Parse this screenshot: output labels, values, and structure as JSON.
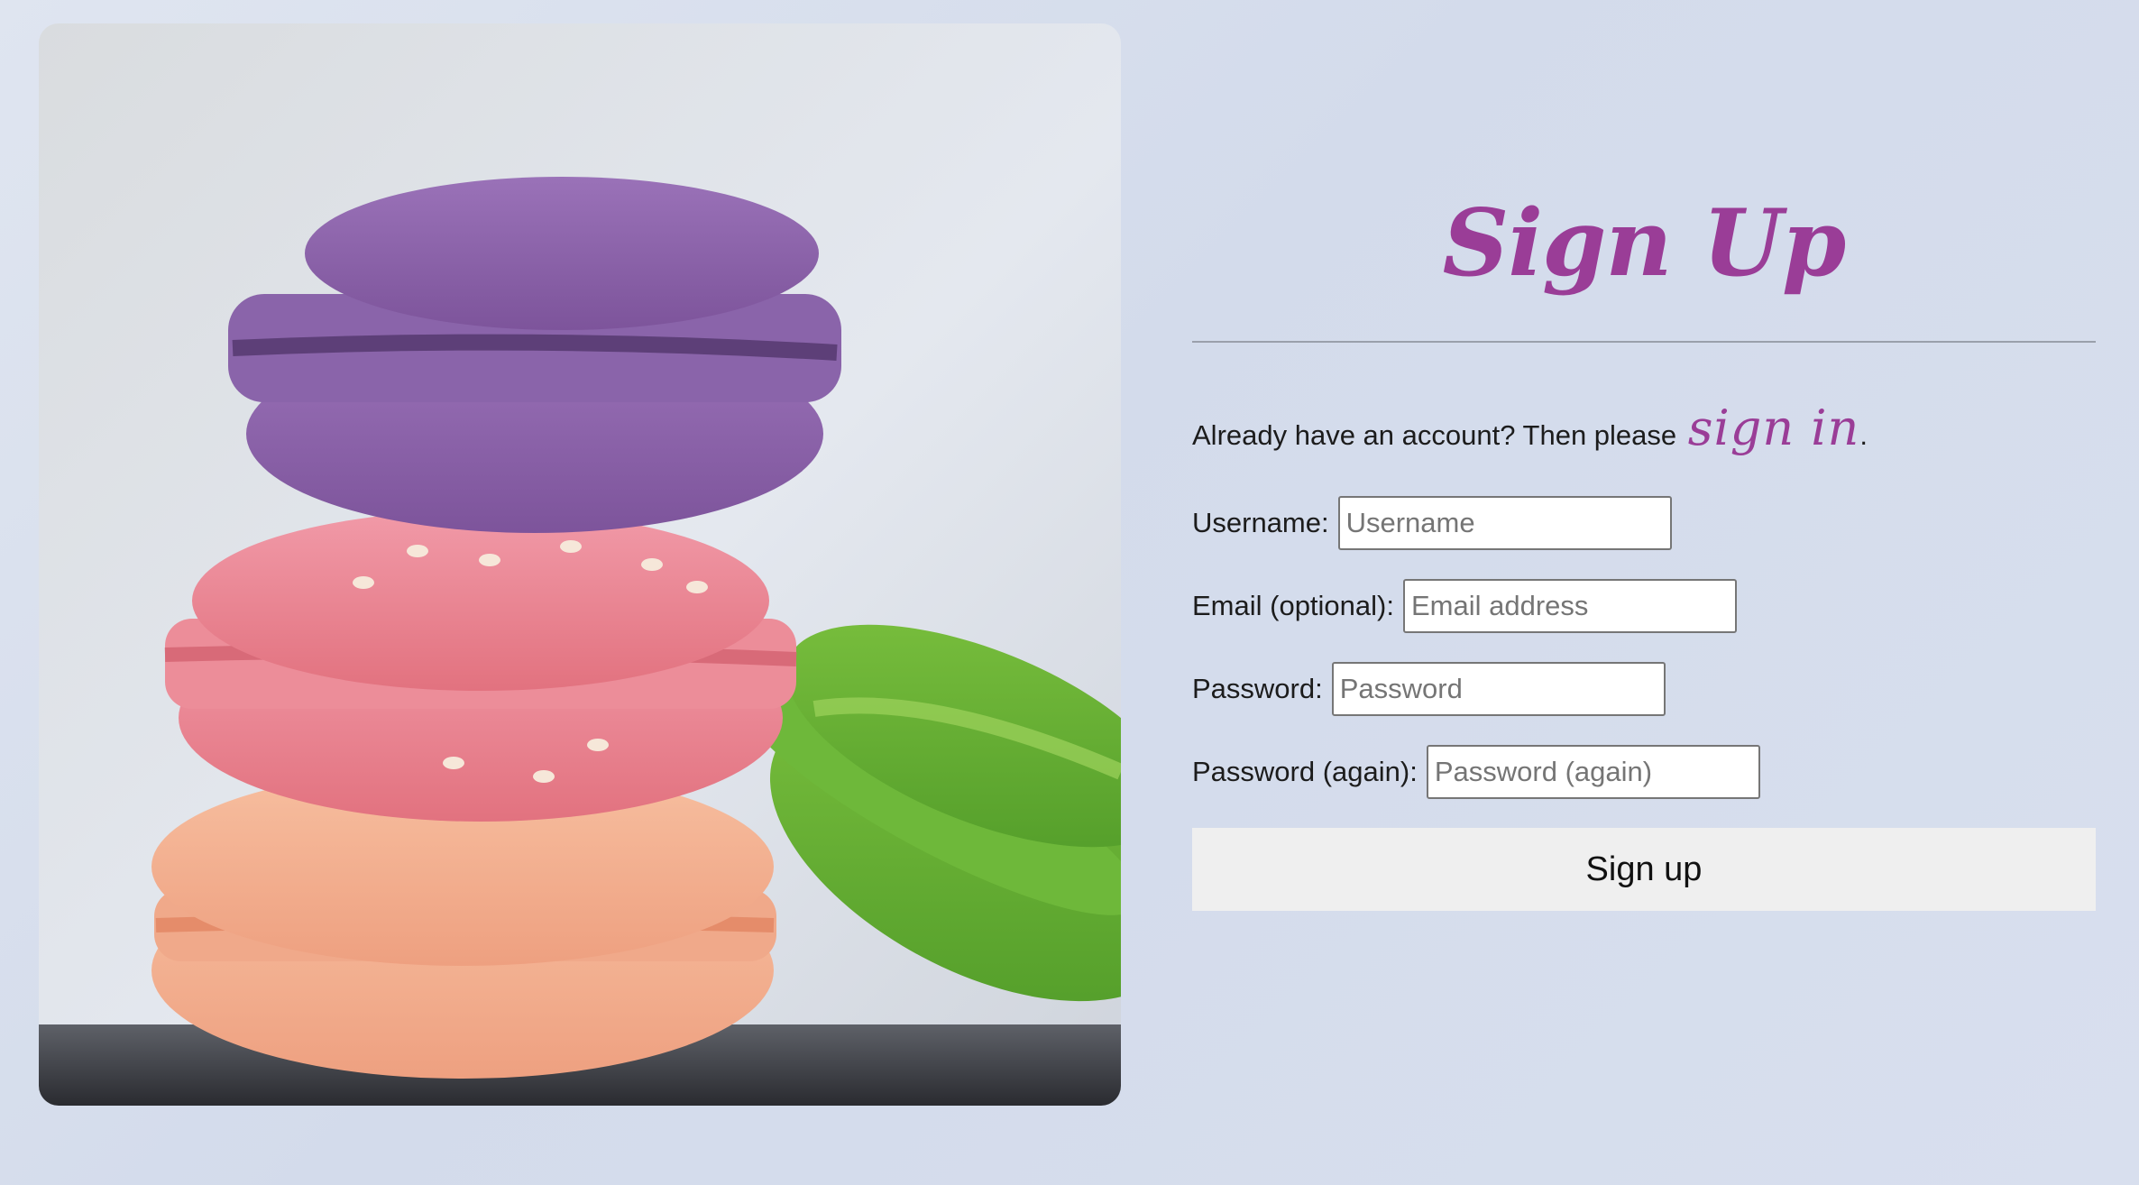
{
  "hero": {
    "alt": "Stack of colorful macarons: purple, pink, peach and green"
  },
  "form": {
    "title": "Sign Up",
    "signin_prompt": "Already have an account? Then please",
    "signin_link": "sign in",
    "signin_suffix": ".",
    "fields": {
      "username": {
        "label": "Username:",
        "placeholder": "Username",
        "value": ""
      },
      "email": {
        "label": "Email (optional):",
        "placeholder": "Email address",
        "value": ""
      },
      "password": {
        "label": "Password:",
        "placeholder": "Password",
        "value": ""
      },
      "password_again": {
        "label": "Password (again):",
        "placeholder": "Password (again)",
        "value": ""
      }
    },
    "submit_label": "Sign up"
  },
  "colors": {
    "accent": "#9a3d97",
    "background": "#d6ddec",
    "button": "#efefef"
  }
}
